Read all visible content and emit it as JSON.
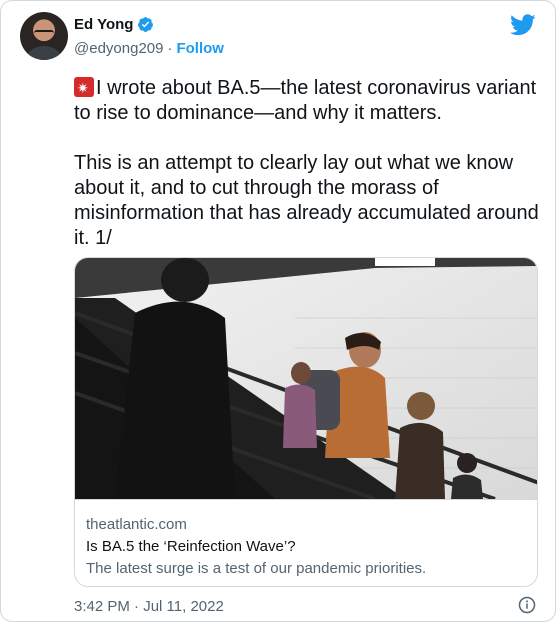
{
  "author": {
    "name": "Ed Yong",
    "handle": "@edyong209",
    "separator": "·",
    "follow_label": "Follow",
    "verified_icon": "verified-badge-icon"
  },
  "tweet": {
    "emoji_icon": "rotating-light-icon",
    "text": "I wrote about BA.5—the latest coronavirus variant to rise to dominance—and why it matters.\n\nThis is an attempt to clearly lay out what we know about it, and to cut through the morass of misinformation that has already accumulated around it. 1/"
  },
  "card": {
    "domain": "theatlantic.com",
    "title": "Is BA.5 the ‘Reinfection Wave’?",
    "description": "The latest surge is a test of our pandemic priorities."
  },
  "footer": {
    "timestamp": "3:42 PM · Jul 11, 2022",
    "info_icon": "info-icon"
  },
  "colors": {
    "accent": "#1d9bf0",
    "text": "#0f1419",
    "muted": "#536471",
    "border": "#cfd9de"
  }
}
